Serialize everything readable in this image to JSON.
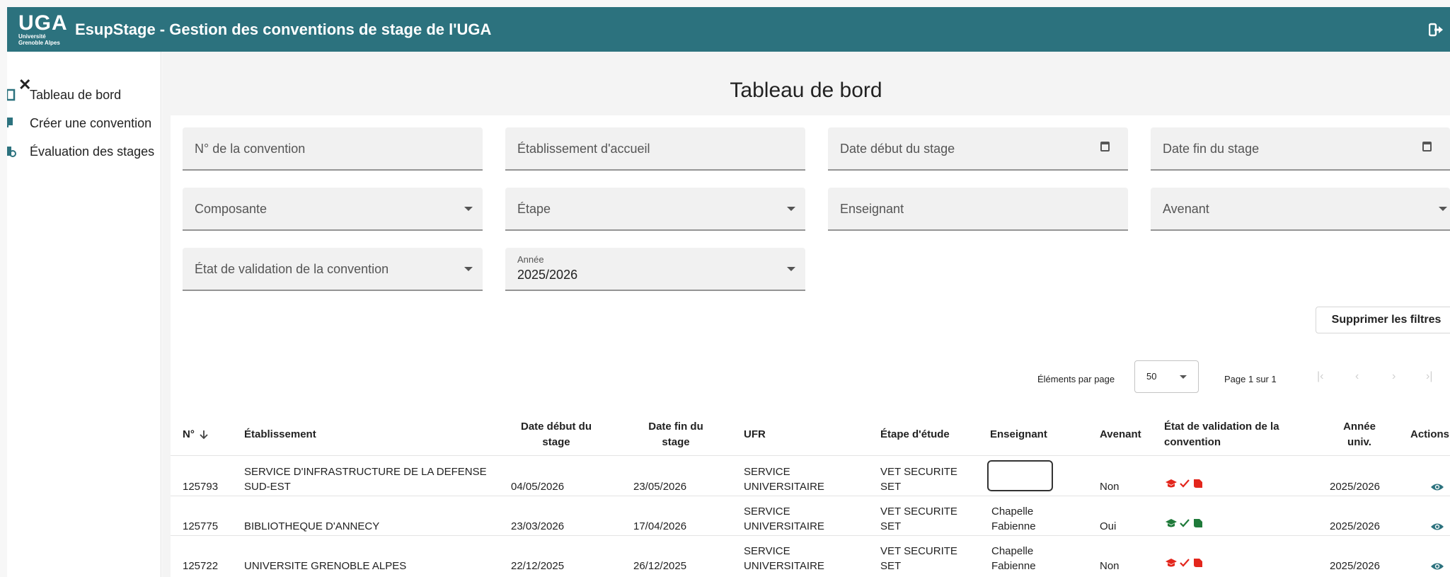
{
  "header": {
    "logo_mark": "UGA",
    "logo_sub1": "Université",
    "logo_sub2": "Grenoble Alpes",
    "title": "EsupStage - Gestion des conventions de stage de l'UGA"
  },
  "sidebar": {
    "items": [
      {
        "label": "Tableau de bord",
        "icon": "clipboard-icon"
      },
      {
        "label": "Créer une convention",
        "icon": "document-add-icon"
      },
      {
        "label": "Évaluation des stages",
        "icon": "evaluation-icon"
      }
    ]
  },
  "page": {
    "title": "Tableau de bord"
  },
  "filters": {
    "convention_number": "N° de la convention",
    "host_establishment": "Établissement d'accueil",
    "start_date": "Date début du stage",
    "end_date": "Date fin du stage",
    "component": "Composante",
    "stage": "Étape",
    "teacher": "Enseignant",
    "amendment": "Avenant",
    "validation_state": "État de validation de la convention",
    "year_label": "Année",
    "year_value": "2025/2026",
    "clear_button": "Supprimer les filtres"
  },
  "pagination": {
    "items_per_page_label": "Éléments par page",
    "items_per_page": "50",
    "page_info": "Page 1 sur 1"
  },
  "table": {
    "headers": {
      "num": "N°",
      "establishment": "Établissement",
      "start_l1": "Date début du",
      "start_l2": "stage",
      "end_l1": "Date fin du",
      "end_l2": "stage",
      "ufr": "UFR",
      "stage": "Étape d'étude",
      "teacher": "Enseignant",
      "amendment": "Avenant",
      "validation_l1": "État de validation de la",
      "validation_l2": "convention",
      "year_l1": "Année",
      "year_l2": "univ.",
      "actions": "Actions"
    },
    "rows": [
      {
        "num": "125793",
        "establishment_l1": "SERVICE D'INFRASTRUCTURE DE LA DEFENSE",
        "establishment_l2": "SUD-EST",
        "start": "04/05/2026",
        "end": "23/05/2026",
        "ufr_l1": "SERVICE",
        "ufr_l2": "UNIVERSITAIRE",
        "stage_l1": "VET SECURITE",
        "stage_l2": "SET",
        "teacher_l1": "",
        "teacher_l2": "",
        "amendment": "Non",
        "year": "2025/2026",
        "status_color": "#e3261c"
      },
      {
        "num": "125775",
        "establishment_l1": "BIBLIOTHEQUE D'ANNECY",
        "establishment_l2": "",
        "start": "23/03/2026",
        "end": "17/04/2026",
        "ufr_l1": "SERVICE",
        "ufr_l2": "UNIVERSITAIRE",
        "stage_l1": "VET SECURITE",
        "stage_l2": "SET",
        "teacher_l1": "Chapelle",
        "teacher_l2": "Fabienne",
        "amendment": "Oui",
        "year": "2025/2026",
        "status_color": "#1f7a3a"
      },
      {
        "num": "125722",
        "establishment_l1": "UNIVERSITE GRENOBLE ALPES",
        "establishment_l2": "",
        "start": "22/12/2025",
        "end": "26/12/2025",
        "ufr_l1": "SERVICE",
        "ufr_l2": "UNIVERSITAIRE",
        "stage_l1": "VET SECURITE",
        "stage_l2": "SET",
        "teacher_l1": "Chapelle",
        "teacher_l2": "Fabienne",
        "amendment": "Non",
        "year": "2025/2026",
        "status_color": "#e3261c"
      }
    ]
  },
  "colors": {
    "header_bg": "#2c727e",
    "eye_icon": "#2c727e"
  }
}
